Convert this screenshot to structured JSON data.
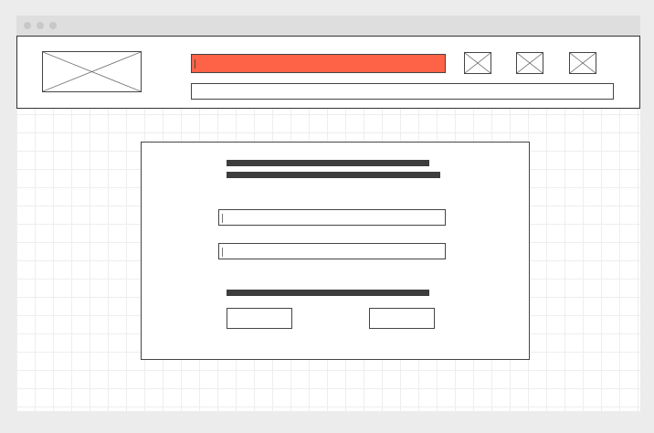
{
  "window": {
    "title": "",
    "traffic_lights": [
      "close",
      "minimize",
      "maximize"
    ]
  },
  "header": {
    "logo_icon": "image-placeholder-icon",
    "search_value": "",
    "address_value": "",
    "icons": [
      "image-placeholder-icon",
      "image-placeholder-icon",
      "image-placeholder-icon"
    ],
    "accent_color": "#ff6347"
  },
  "card": {
    "heading_line_1": "",
    "heading_line_2": "",
    "field_1_value": "",
    "field_2_value": "",
    "footer_line": "",
    "primary_button_label": "",
    "secondary_button_label": ""
  }
}
